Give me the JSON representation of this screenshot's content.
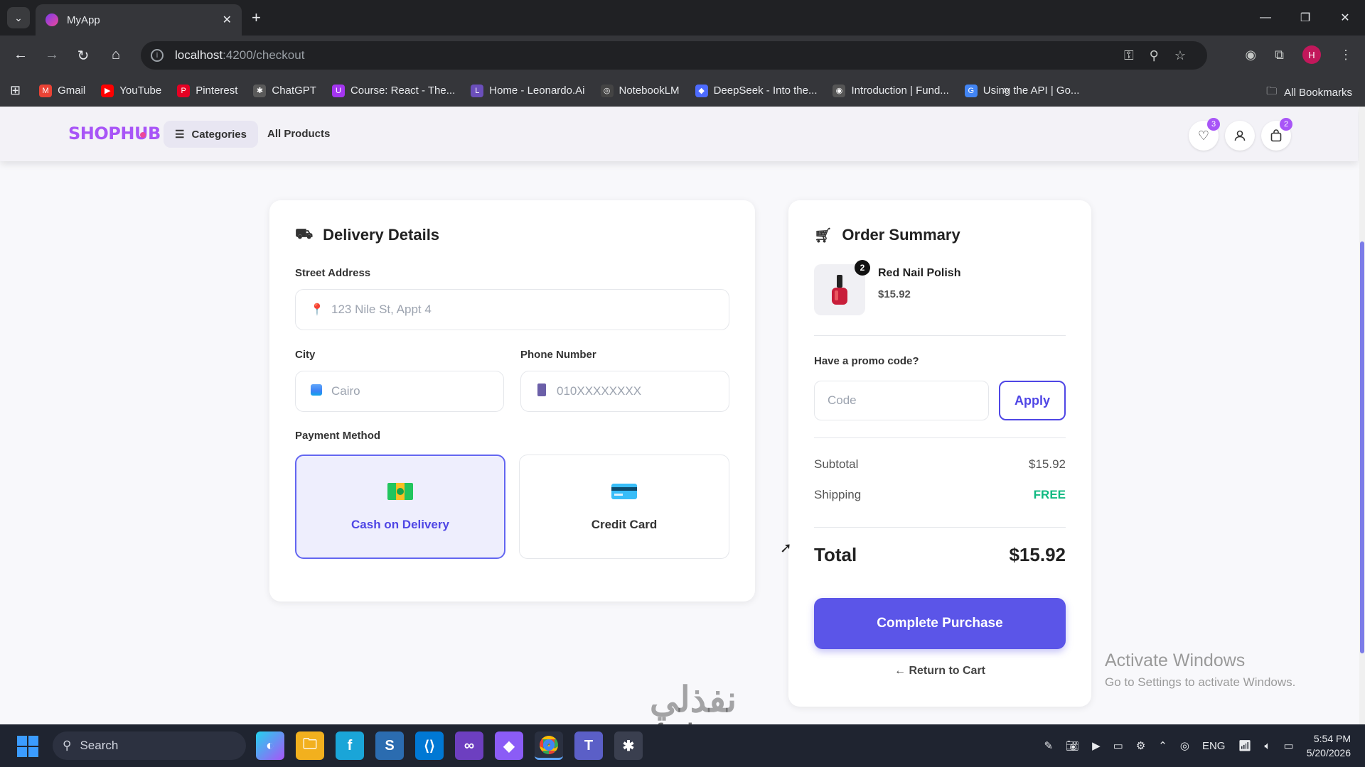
{
  "browser": {
    "tab_title": "MyApp",
    "url_host": "localhost",
    "url_rest": ":4200/checkout",
    "bookmarks": [
      {
        "label": "Gmail",
        "color": "#ea4335",
        "glyph": "M"
      },
      {
        "label": "YouTube",
        "color": "#ff0000",
        "glyph": "▶"
      },
      {
        "label": "Pinterest",
        "color": "#e60023",
        "glyph": "P"
      },
      {
        "label": "ChatGPT",
        "color": "#5a5a5a",
        "glyph": "✱"
      },
      {
        "label": "Course: React - The...",
        "color": "#a435f0",
        "glyph": "U"
      },
      {
        "label": "Home - Leonardo.Ai",
        "color": "#6b4fbb",
        "glyph": "L"
      },
      {
        "label": "NotebookLM",
        "color": "#444",
        "glyph": "◎"
      },
      {
        "label": "DeepSeek - Into the...",
        "color": "#4d6bfe",
        "glyph": "◆"
      },
      {
        "label": "Introduction | Fund...",
        "color": "#555",
        "glyph": "◉"
      },
      {
        "label": "Using the API | Go...",
        "color": "#4285f4",
        "glyph": "G"
      }
    ],
    "all_bookmarks": "All Bookmarks"
  },
  "header": {
    "logo": "SHOPHUB",
    "categories": "Categories",
    "all_products": "All Products",
    "wishlist_count": "3",
    "cart_count": "2"
  },
  "delivery": {
    "title": "Delivery Details",
    "street_label": "Street Address",
    "street_placeholder": "123 Nile St, Appt 4",
    "city_label": "City",
    "city_placeholder": "Cairo",
    "phone_label": "Phone Number",
    "phone_placeholder": "010XXXXXXXX",
    "payment_label": "Payment Method",
    "payment_options": [
      {
        "label": "Cash on Delivery",
        "selected": true
      },
      {
        "label": "Credit Card",
        "selected": false
      }
    ]
  },
  "summary": {
    "title": "Order Summary",
    "item_name": "Red Nail Polish",
    "item_price": "$15.92",
    "item_qty": "2",
    "promo_label": "Have a promo code?",
    "promo_placeholder": "Code",
    "apply": "Apply",
    "subtotal_label": "Subtotal",
    "subtotal_value": "$15.92",
    "shipping_label": "Shipping",
    "shipping_value": "FREE",
    "total_label": "Total",
    "total_value": "$15.92",
    "purchase_button": "Complete Purchase",
    "return_link": "← Return to Cart"
  },
  "overlay": {
    "activate_title": "Activate Windows",
    "activate_sub": "Go to Settings to activate Windows.",
    "watermark_ar": "نفذلي",
    "watermark_en": "nafezly.com"
  },
  "taskbar": {
    "search": "Search",
    "lang": "ENG",
    "time": "5:54 PM",
    "date": "5/20/2026"
  },
  "colors": {
    "accent": "#5b55e8",
    "brand": "#a855f7",
    "free": "#10b981"
  }
}
